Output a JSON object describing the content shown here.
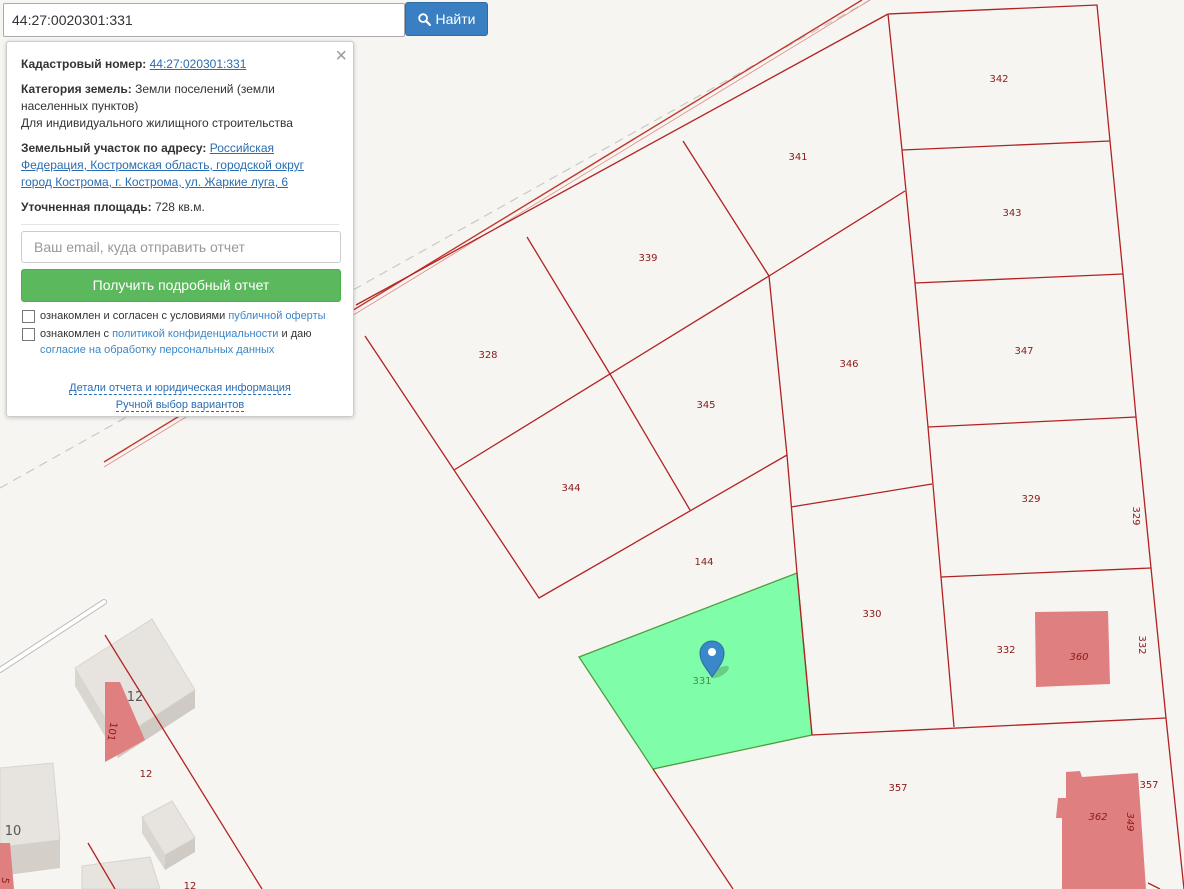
{
  "search": {
    "value": "44:27:0020301:331",
    "button_label": "Найти",
    "button_icon": "search-icon"
  },
  "info_panel": {
    "cadastral_label": "Кадастровый номер:",
    "cadastral_number": "44:27:020301:331",
    "category_label": "Категория земель:",
    "category_line1": "Земли поселений (земли",
    "category_line2": "населенных пунктов)",
    "permitted_use": "Для индивидуального жилищного строительства",
    "address_label": "Земельный участок по адресу:",
    "address_part1": "Российская",
    "address_part2": "Федерация, Костромская область, городской округ",
    "address_part3": "город Кострома, г. Кострома, ул. Жаркие луга, 6",
    "area_label": "Уточненная площадь:",
    "area_value": "728 кв.м.",
    "email_placeholder": "Ваш email, куда отправить отчет",
    "report_button": "Получить подробный отчет",
    "consent1_text": "ознакомлен и согласен с условиями",
    "consent1_link": "публичной оферты",
    "consent2_text_a": "ознакомлен с",
    "consent2_link_a": "политикой конфиденциальности",
    "consent2_text_b": "и даю",
    "consent2_link_b": "согласие на обработку персональных данных",
    "details_link": "Детали отчета и юридическая информация",
    "manual_link": "Ручной выбор вариантов"
  },
  "map": {
    "colors": {
      "background": "#f6f5f1",
      "parcel_border": "#b22222",
      "selected_fill": "#7ffda9",
      "building_red": "#e07f7f",
      "building_gray": "#e6e3de",
      "marker": "#3a87c9"
    },
    "plot_labels": {
      "p342": "342",
      "p341": "341",
      "p343": "343",
      "p339": "339",
      "p328": "328",
      "p345": "345",
      "p346": "346",
      "p347": "347",
      "p344": "344",
      "p144": "144",
      "p329": "329",
      "p329v": "329",
      "p330": "330",
      "p331": "331",
      "p332": "332",
      "p332v": "332",
      "p360": "360",
      "p357": "357",
      "p357b": "357",
      "p362": "362",
      "p349v": "349",
      "p101": "101",
      "p12a": "12",
      "p12b": "12",
      "p12c": "12",
      "p10": "10",
      "p5": "5"
    }
  }
}
